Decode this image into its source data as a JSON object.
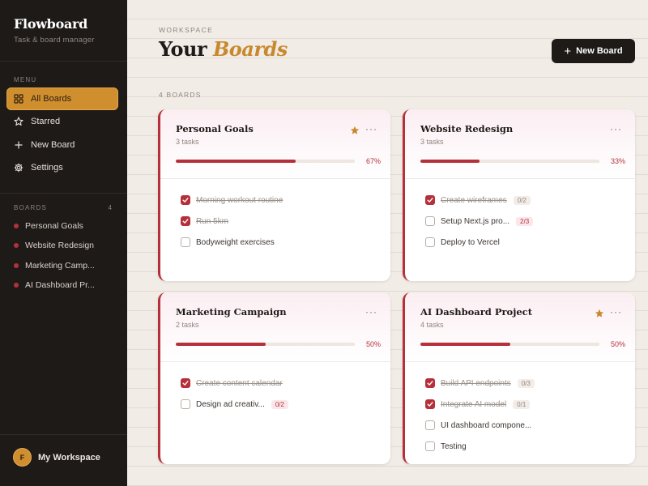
{
  "app": {
    "name": "Flowboard",
    "tagline": "Task & board manager"
  },
  "sidebar": {
    "menu_label": "MENU",
    "items": [
      {
        "label": "All Boards",
        "icon": "grid-icon",
        "active": true
      },
      {
        "label": "Starred",
        "icon": "star-icon",
        "active": false
      },
      {
        "label": "New Board",
        "icon": "plus-icon",
        "active": false
      },
      {
        "label": "Settings",
        "icon": "gear-icon",
        "active": false
      }
    ],
    "boards_label": "BOARDS",
    "boards_count": "4",
    "boards": [
      "Personal Goals",
      "Website Redesign",
      "Marketing Camp...",
      "AI Dashboard Pr..."
    ],
    "workspace": {
      "initial": "F",
      "name": "My Workspace"
    }
  },
  "header": {
    "eyebrow": "WORKSPACE",
    "title_plain": "Your",
    "title_accent": "Boards",
    "new_board_label": "New Board"
  },
  "board_count_label": "4 BOARDS",
  "colors": {
    "accent": "#d08f2e",
    "brand_red": "#b5303b",
    "sidebar_bg": "#1e1a18"
  },
  "boards": [
    {
      "title": "Personal Goals",
      "subtitle": "3 tasks",
      "starred": true,
      "progress": 0.67,
      "progress_label": "67%",
      "tasks": [
        {
          "label": "Morning workout routine",
          "done": true,
          "badge": ""
        },
        {
          "label": "Run 5km",
          "done": true,
          "badge": ""
        },
        {
          "label": "Bodyweight exercises",
          "done": false,
          "badge": ""
        }
      ]
    },
    {
      "title": "Website Redesign",
      "subtitle": "3 tasks",
      "starred": false,
      "progress": 0.33,
      "progress_label": "33%",
      "tasks": [
        {
          "label": "Create wireframes",
          "done": true,
          "badge": "0/2"
        },
        {
          "label": "Setup Next.js pro...",
          "done": false,
          "badge": "2/3"
        },
        {
          "label": "Deploy to Vercel",
          "done": false,
          "badge": ""
        }
      ]
    },
    {
      "title": "Marketing Campaign",
      "subtitle": "2 tasks",
      "starred": false,
      "progress": 0.5,
      "progress_label": "50%",
      "tasks": [
        {
          "label": "Create content calendar",
          "done": true,
          "badge": ""
        },
        {
          "label": "Design ad creativ...",
          "done": false,
          "badge": "0/2"
        }
      ]
    },
    {
      "title": "AI Dashboard Project",
      "subtitle": "4 tasks",
      "starred": true,
      "progress": 0.5,
      "progress_label": "50%",
      "tasks": [
        {
          "label": "Build API endpoints",
          "done": true,
          "badge": "0/3"
        },
        {
          "label": "Integrate AI model",
          "done": true,
          "badge": "0/1"
        },
        {
          "label": "UI dashboard compone...",
          "done": false,
          "badge": ""
        },
        {
          "label": "Testing",
          "done": false,
          "badge": ""
        }
      ]
    }
  ]
}
